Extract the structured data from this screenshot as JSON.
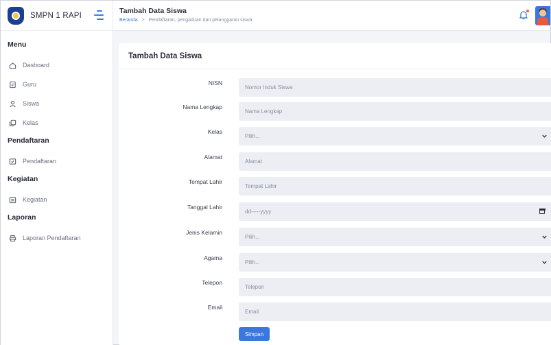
{
  "brand": {
    "name": "SMPN 1 RAPI"
  },
  "sidebar": {
    "sections": [
      {
        "title": "Menu",
        "items": [
          {
            "label": "Dasboard",
            "icon": "home-icon"
          },
          {
            "label": "Guru",
            "icon": "document-icon"
          },
          {
            "label": "Siswa",
            "icon": "user-icon"
          },
          {
            "label": "Kelas",
            "icon": "copy-icon"
          }
        ]
      },
      {
        "title": "Pendaftaran",
        "items": [
          {
            "label": "Pendaftaran",
            "icon": "message-square-icon"
          }
        ]
      },
      {
        "title": "Kegiatan",
        "items": [
          {
            "label": "Kegiatan",
            "icon": "calendar-list-icon"
          }
        ]
      },
      {
        "title": "Laporan",
        "items": [
          {
            "label": "Laporan Pendaftaran",
            "icon": "printer-icon"
          }
        ]
      }
    ]
  },
  "header": {
    "title": "Tambah Data Siswa",
    "breadcrumb": {
      "home": "Beranda",
      "separator": ">",
      "current": "Pendaftaran, pengaduan dan pelanggaran siswa"
    }
  },
  "card": {
    "title": "Tambah Data Siswa"
  },
  "form": {
    "fields": [
      {
        "label": "NISN",
        "placeholder": "Nomor Induk Siswa",
        "type": "text"
      },
      {
        "label": "Nama Lengkap",
        "placeholder": "Nama Lengkap",
        "type": "text"
      },
      {
        "label": "Kelas",
        "placeholder": "Pilih...",
        "type": "select"
      },
      {
        "label": "Alamat",
        "placeholder": "Alamat",
        "type": "text"
      },
      {
        "label": "Tempat Lahir",
        "placeholder": "Tempat Lahir",
        "type": "text"
      },
      {
        "label": "Tanggal Lahir",
        "placeholder": "dd-----yyyy",
        "type": "date"
      },
      {
        "label": "Jenis Kelamin",
        "placeholder": "Pilih...",
        "type": "select"
      },
      {
        "label": "Agama",
        "placeholder": "Pilih...",
        "type": "select"
      },
      {
        "label": "Telepon",
        "placeholder": "Telepon",
        "type": "text"
      },
      {
        "label": "Email",
        "placeholder": "Email",
        "type": "text"
      }
    ],
    "submit_label": "Simpan"
  },
  "colors": {
    "accent": "#3a78e0",
    "field_bg": "#eceef4",
    "page_bg": "#f3f5f9"
  }
}
